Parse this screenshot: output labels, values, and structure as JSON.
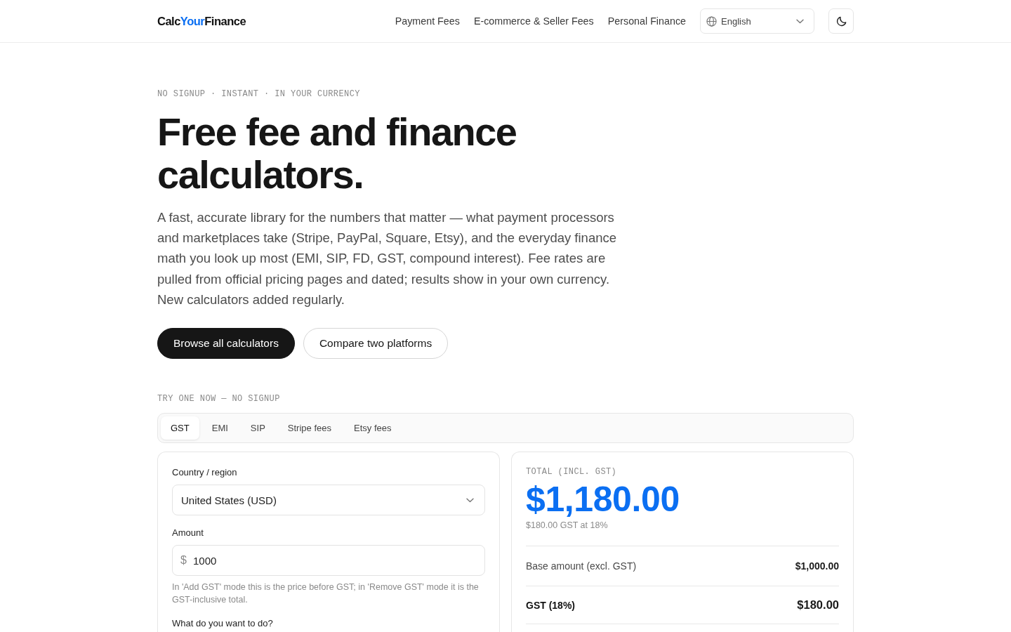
{
  "header": {
    "logo": {
      "lead": "Calc",
      "accent": "Your",
      "tail": "Finance"
    },
    "nav": [
      "Payment Fees",
      "E-commerce & Seller Fees",
      "Personal Finance"
    ],
    "language_select": {
      "value": "English"
    }
  },
  "hero": {
    "eyebrow": "NO SIGNUP · INSTANT · IN YOUR CURRENCY",
    "title": "Free fee and finance calculators.",
    "description": "A fast, accurate library for the numbers that matter — what payment processors and marketplaces take (Stripe, PayPal, Square, Etsy), and the everyday finance math you look up most (EMI, SIP, FD, GST, compound interest). Fee rates are pulled from official pricing pages and dated; results show in your own currency. New calculators added regularly.",
    "buttons": [
      {
        "label": "Browse all calculators",
        "kind": "primary"
      },
      {
        "label": "Compare two platforms",
        "kind": "secondary"
      }
    ]
  },
  "try_section": {
    "eyebrow": "TRY ONE NOW — NO SIGNUP",
    "tabs": [
      {
        "label": "GST",
        "selected": true
      },
      {
        "label": "EMI",
        "selected": false
      },
      {
        "label": "SIP",
        "selected": false
      },
      {
        "label": "Stripe fees",
        "selected": false
      },
      {
        "label": "Etsy fees",
        "selected": false
      }
    ]
  },
  "calculator": {
    "fields": [
      {
        "kind": "select",
        "label": "Country / region",
        "value": "United States (USD)"
      },
      {
        "kind": "currency",
        "label": "Amount",
        "prefix": "$",
        "value": "1000",
        "hint": "In 'Add GST' mode this is the price before GST; in 'Remove GST' mode it is the GST-inclusive total."
      },
      {
        "kind": "choice",
        "label": "What do you want to do?"
      }
    ]
  },
  "result": {
    "label": "TOTAL (INCL. GST)",
    "total": "$1,180.00",
    "note": "$180.00 GST at 18%",
    "rows": [
      {
        "kind": "normal",
        "label": "Base amount (excl. GST)",
        "value": "$1,000.00"
      },
      {
        "kind": "strong",
        "label": "GST (18%)",
        "value": "$180.00"
      }
    ]
  }
}
